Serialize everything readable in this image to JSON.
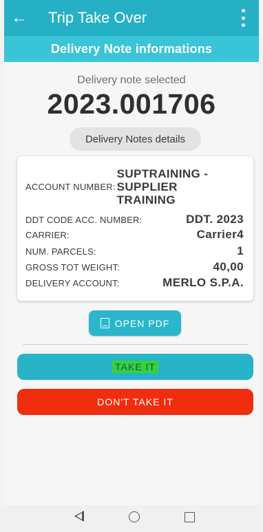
{
  "app_bar": {
    "title": "Trip Take Over",
    "back_icon": "arrow-left-icon",
    "menu_icon": "more-vert-icon"
  },
  "sub_bar": {
    "title": "Delivery Note informations"
  },
  "selection": {
    "label": "Delivery note selected",
    "number": "2023.001706"
  },
  "details_chip": {
    "label": "Delivery Notes details"
  },
  "details": {
    "account_number": {
      "label": "ACCOUNT NUMBER:",
      "value": "SUPTRAINING - SUPPLIER TRAINING"
    },
    "ddt_code": {
      "label": "DDT CODE ACC. NUMBER:",
      "value": "DDT. 2023"
    },
    "carrier": {
      "label": "CARRIER:",
      "value": "Carrier4"
    },
    "num_parcels": {
      "label": "NUM. PARCELS:",
      "value": "1"
    },
    "gross_weight": {
      "label": "GROSS TOT WEIGHT:",
      "value": "40,00"
    },
    "delivery_account": {
      "label": "DELIVERY ACCOUNT:",
      "value": "MERLO S.P.A."
    }
  },
  "actions": {
    "open_pdf": "OPEN PDF",
    "take_it": "TAKE IT",
    "dont_take_it": "DON'T TAKE IT"
  },
  "colors": {
    "primary": "#26b0c6",
    "secondary": "#39c4d8",
    "danger": "#f12d10",
    "highlight": "#36d23c"
  }
}
